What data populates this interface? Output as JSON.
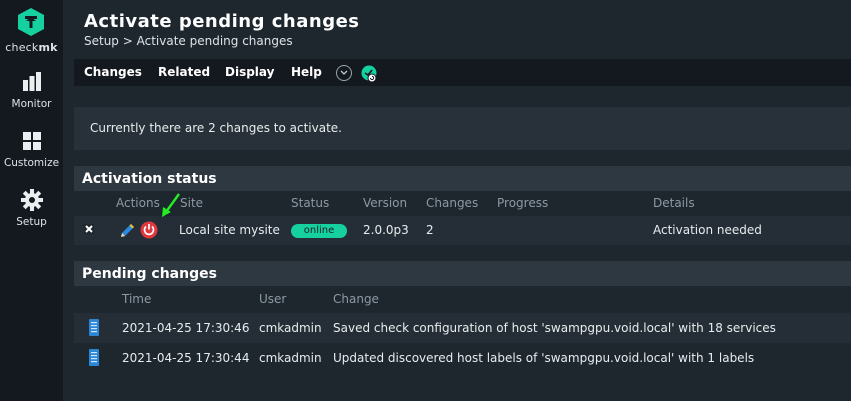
{
  "sidebar": {
    "logo_text_light": "check",
    "logo_text_bold": "mk",
    "items": [
      {
        "label": "Monitor",
        "icon": "bar-chart-icon"
      },
      {
        "label": "Customize",
        "icon": "grid-icon"
      },
      {
        "label": "Setup",
        "icon": "gear-icon"
      }
    ]
  },
  "header": {
    "title": "Activate pending changes",
    "breadcrumb": "Setup > Activate pending changes"
  },
  "menubar": {
    "items": [
      "Changes",
      "Related",
      "Display",
      "Help"
    ]
  },
  "info": {
    "message": "Currently there are 2 changes to activate."
  },
  "activation_status": {
    "title": "Activation status",
    "columns": [
      "Actions",
      "Site",
      "Status",
      "Version",
      "Changes",
      "Progress",
      "Details"
    ],
    "row": {
      "site": "Local site mysite",
      "status": "online",
      "version": "2.0.0p3",
      "changes": "2",
      "progress": "",
      "details": "Activation needed"
    }
  },
  "pending_changes": {
    "title": "Pending changes",
    "columns": [
      "Time",
      "User",
      "Change"
    ],
    "rows": [
      {
        "time": "2021-04-25 17:30:46",
        "user": "cmkadmin",
        "change": "Saved check configuration of host 'swampgpu.void.local' with 18 services"
      },
      {
        "time": "2021-04-25 17:30:44",
        "user": "cmkadmin",
        "change": "Updated discovered host labels of 'swampgpu.void.local' with 1 labels"
      }
    ]
  },
  "colors": {
    "accent": "#15d1a0",
    "background": "#1e262e",
    "sidebar": "#13191f",
    "panel": "#283139",
    "reload_red": "#e0383e",
    "arrow_green": "#22ee22"
  }
}
